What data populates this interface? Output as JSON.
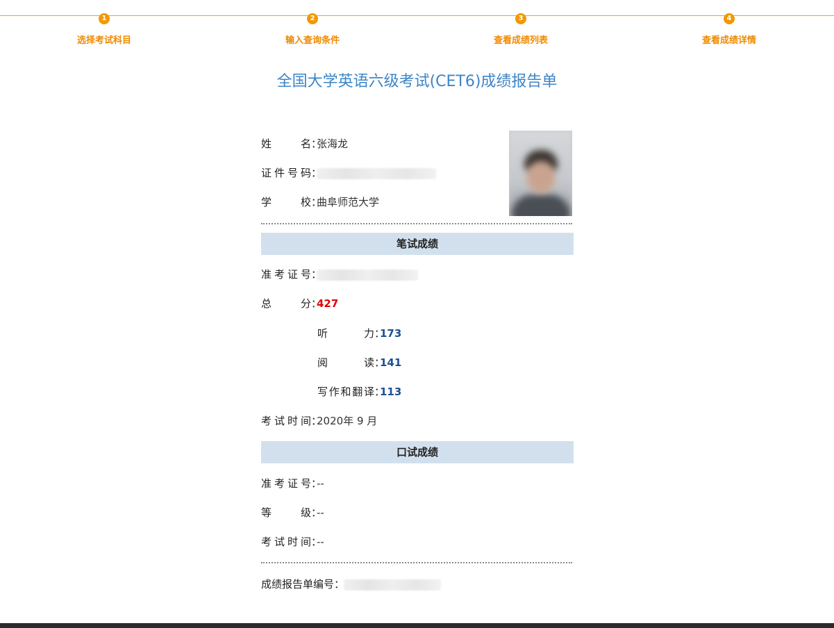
{
  "steps": [
    {
      "num": "1",
      "label": "选择考试科目"
    },
    {
      "num": "2",
      "label": "输入查询条件"
    },
    {
      "num": "3",
      "label": "查看成绩列表"
    },
    {
      "num": "4",
      "label": "查看成绩详情"
    }
  ],
  "report": {
    "title": "全国大学英语六级考试(CET6)成绩报告单",
    "name_label": "姓名",
    "name_value": "张海龙",
    "id_label": "证件号码",
    "school_label": "学校",
    "school_value": "曲阜师范大学",
    "colon": "：",
    "written": {
      "section_title": "笔试成绩",
      "ticket_label": "准考证号",
      "total_label": "总分",
      "total_value": "427",
      "listening_label": "听力",
      "listening_value": "173",
      "reading_label": "阅读",
      "reading_value": "141",
      "writing_label": "写作和翻译",
      "writing_value": "113",
      "time_label": "考试时间",
      "time_value": "2020年 9 月"
    },
    "oral": {
      "section_title": "口试成绩",
      "ticket_label": "准考证号",
      "ticket_value": "--",
      "level_label": "等级",
      "level_value": "--",
      "time_label": "考试时间",
      "time_value": "--"
    },
    "report_no_label": "成绩报告单编号"
  },
  "icons": {
    "photo": "candidate-photo"
  },
  "colors": {
    "step_orange": "#f39800",
    "title_blue": "#3d85c6",
    "total_red": "#e00000",
    "sub_score_blue": "#1d4f91",
    "section_bg": "#d2e0ee"
  }
}
